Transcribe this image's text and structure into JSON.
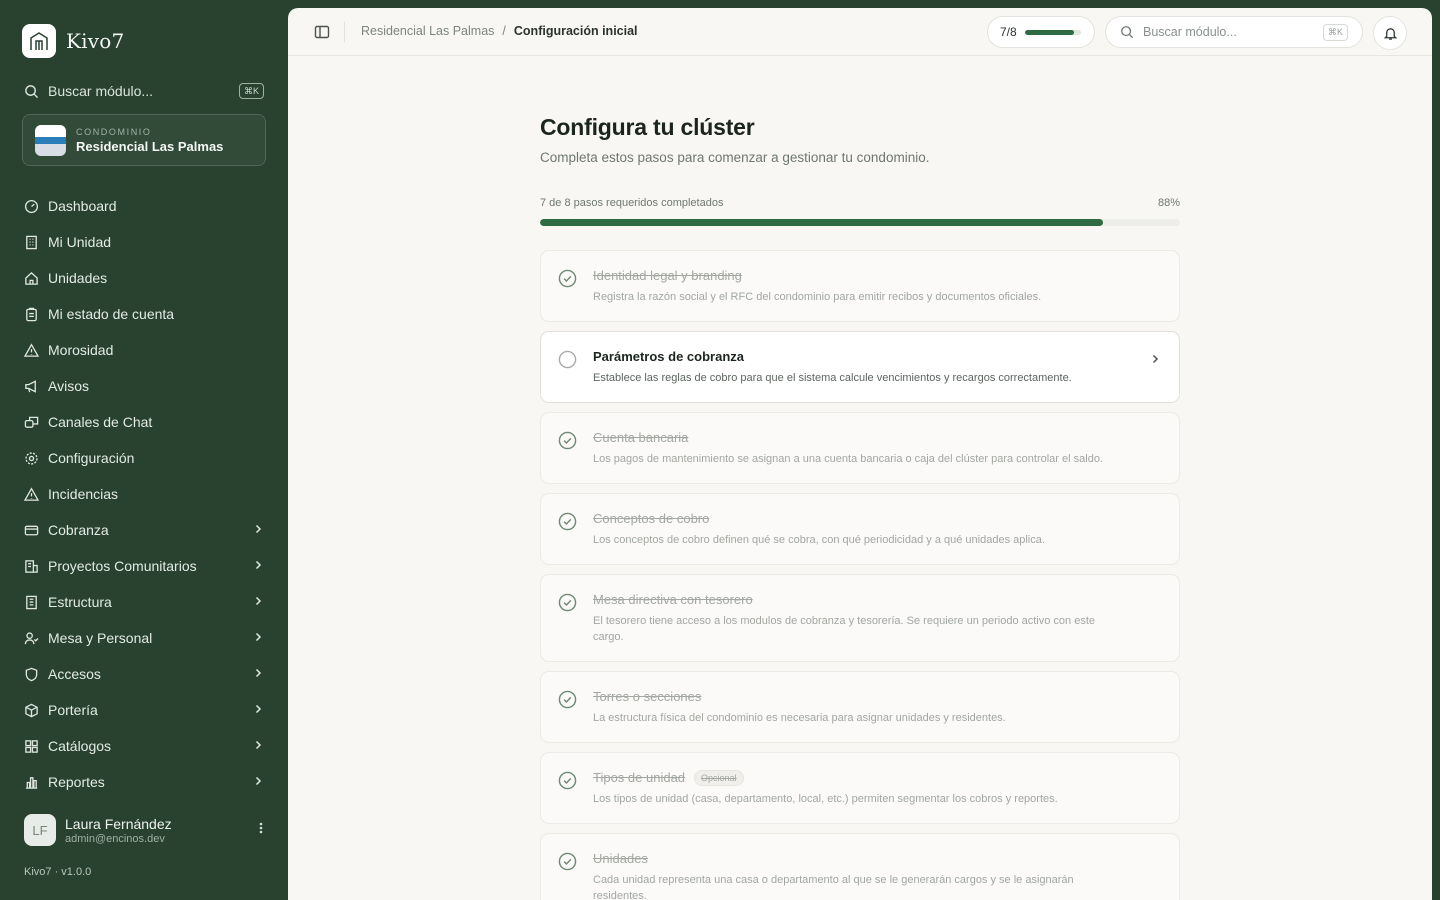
{
  "sidebar": {
    "brand": "Kivo7",
    "search": {
      "placeholder": "Buscar módulo...",
      "shortcut": "⌘K"
    },
    "condo": {
      "kicker": "CONDOMINIO",
      "name": "Residencial Las Palmas"
    },
    "items": [
      {
        "label": "Dashboard",
        "icon": "gauge-icon",
        "expandable": false
      },
      {
        "label": "Mi Unidad",
        "icon": "building-icon",
        "expandable": false
      },
      {
        "label": "Unidades",
        "icon": "home-icon",
        "expandable": false
      },
      {
        "label": "Mi estado de cuenta",
        "icon": "clipboard-icon",
        "expandable": false
      },
      {
        "label": "Morosidad",
        "icon": "warning-icon",
        "expandable": false
      },
      {
        "label": "Avisos",
        "icon": "megaphone-icon",
        "expandable": false
      },
      {
        "label": "Canales de Chat",
        "icon": "chat-icon",
        "expandable": false
      },
      {
        "label": "Configuración",
        "icon": "gear-icon",
        "expandable": false
      },
      {
        "label": "Incidencias",
        "icon": "alert-icon",
        "expandable": false
      },
      {
        "label": "Cobranza",
        "icon": "card-icon",
        "expandable": true
      },
      {
        "label": "Proyectos Comunitarios",
        "icon": "projects-icon",
        "expandable": true
      },
      {
        "label": "Estructura",
        "icon": "structure-icon",
        "expandable": true
      },
      {
        "label": "Mesa y Personal",
        "icon": "people-icon",
        "expandable": true
      },
      {
        "label": "Accesos",
        "icon": "shield-icon",
        "expandable": true
      },
      {
        "label": "Portería",
        "icon": "box-icon",
        "expandable": true
      },
      {
        "label": "Catálogos",
        "icon": "grid-icon",
        "expandable": true
      },
      {
        "label": "Reportes",
        "icon": "bar-chart-icon",
        "expandable": true
      }
    ],
    "user": {
      "initials": "LF",
      "name": "Laura Fernández",
      "email": "admin@encinos.dev"
    },
    "version": "Kivo7 · v1.0.0"
  },
  "topbar": {
    "breadcrumb": {
      "parent": "Residencial Las Palmas",
      "separator": "/",
      "current": "Configuración inicial"
    },
    "progress": {
      "label": "7/8",
      "fraction": 0.88
    },
    "search": {
      "placeholder": "Buscar módulo...",
      "shortcut": "⌘K"
    }
  },
  "main": {
    "title": "Configura tu clúster",
    "subtitle": "Completa estos pasos para comenzar a gestionar tu condominio.",
    "progress_label": "7 de 8 pasos requeridos completados",
    "progress_percent": "88%",
    "progress_fraction": 0.88,
    "steps": [
      {
        "title": "Identidad legal y branding",
        "desc": "Registra la razón social y el RFC del condominio para emitir recibos y documentos oficiales.",
        "done": true
      },
      {
        "title": "Parámetros de cobranza",
        "desc": "Establece las reglas de cobro para que el sistema calcule vencimientos y recargos correctamente.",
        "done": false
      },
      {
        "title": "Cuenta bancaria",
        "desc": "Los pagos de mantenimiento se asignan a una cuenta bancaria o caja del clúster para controlar el saldo.",
        "done": true
      },
      {
        "title": "Conceptos de cobro",
        "desc": "Los conceptos de cobro definen qué se cobra, con qué periodicidad y a qué unidades aplica.",
        "done": true
      },
      {
        "title": "Mesa directiva con tesorero",
        "desc": "El tesorero tiene acceso a los modulos de cobranza y tesorería. Se requiere un periodo activo con este cargo.",
        "done": true
      },
      {
        "title": "Torres o secciones",
        "desc": "La estructura física del condominio es necesaria para asignar unidades y residentes.",
        "done": true
      },
      {
        "title": "Tipos de unidad",
        "badge": "Opcional",
        "desc": "Los tipos de unidad (casa, departamento, local, etc.) permiten segmentar los cobros y reportes.",
        "done": true
      },
      {
        "title": "Unidades",
        "desc": "Cada unidad representa una casa o departamento al que se le generarán cargos y se le asignarán residentes.",
        "done": true
      }
    ]
  },
  "colors": {
    "sidebar": "#29412f",
    "accent": "#2e6b42",
    "surface": "#f8f7f4"
  }
}
